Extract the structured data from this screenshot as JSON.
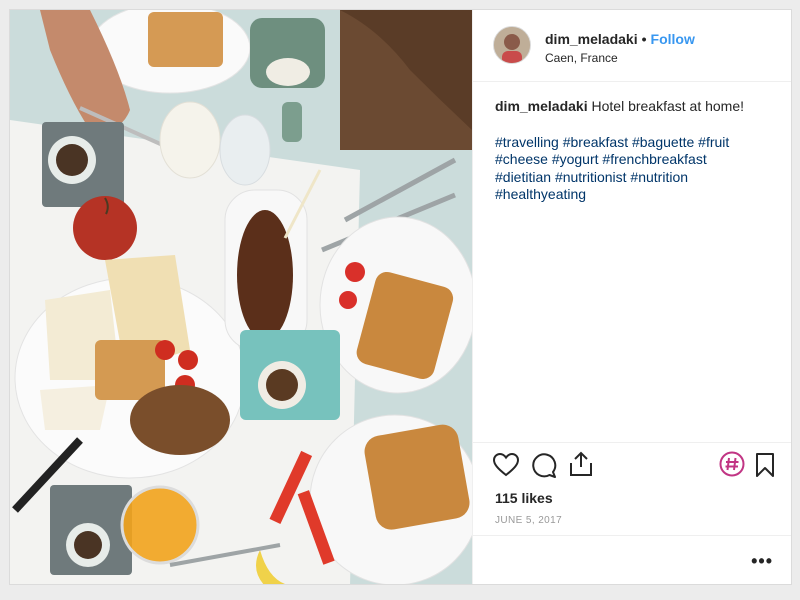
{
  "post": {
    "username": "dim_meladaki",
    "separator": "•",
    "follow_label": "Follow",
    "location": "Caen, France",
    "caption_username": "dim_meladaki",
    "caption_text": "Hotel breakfast at home!",
    "hashtags": [
      "#travelling",
      "#breakfast",
      "#baguette",
      "#fruit",
      "#cheese",
      "#yogurt",
      "#frenchbreakfast",
      "#dietitian",
      "#nutritionist",
      "#nutrition",
      "#healthyeating"
    ],
    "likes": "115 likes",
    "date": "JUNE 5, 2017",
    "more_label": "•••"
  },
  "icons": {
    "like": "heart-icon",
    "comment": "comment-icon",
    "share": "share-icon",
    "hashtag": "hashtag-icon",
    "save": "bookmark-icon"
  },
  "colors": {
    "link_blue": "#3897f0",
    "hashtag_blue": "#003569",
    "hashtag_badge": "#c13584"
  }
}
